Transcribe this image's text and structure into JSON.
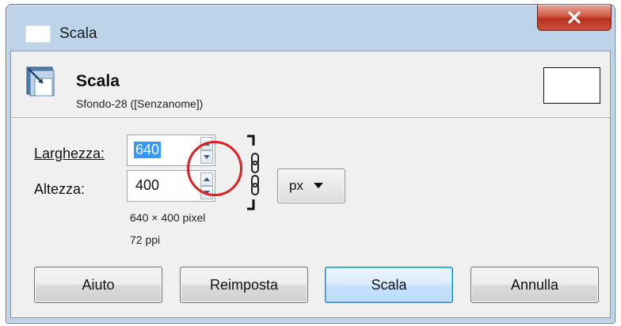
{
  "window": {
    "title": "Scala"
  },
  "header": {
    "title": "Scala",
    "subtitle": "Sfondo-28 ([Senzanome])"
  },
  "form": {
    "width_label": "Larghezza:",
    "width_value": "640",
    "height_label": "Altezza:",
    "height_value": "400",
    "unit_value": "px",
    "size_info": "640 × 400 pixel",
    "resolution_info": "72 ppi"
  },
  "buttons": {
    "help": "Aiuto",
    "reset": "Reimposta",
    "scale": "Scala",
    "cancel": "Annulla"
  },
  "colors": {
    "accent": "#3399ff",
    "annotation": "#e02020",
    "close_button": "#c9503c"
  }
}
